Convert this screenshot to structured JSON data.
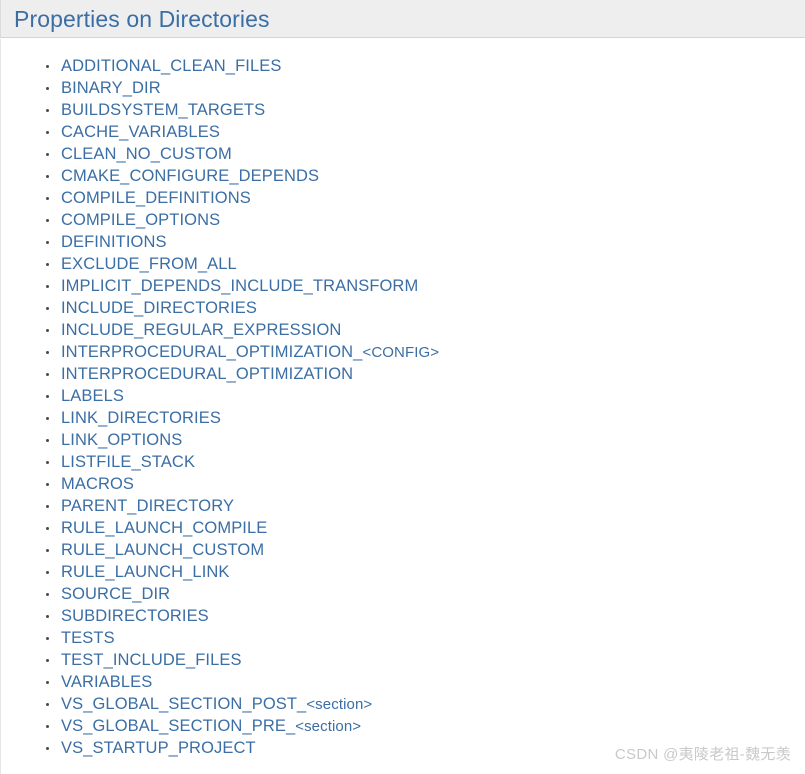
{
  "header": {
    "title": "Properties on Directories",
    "background_color": "#eeeeee",
    "title_color": "#3a6ea5"
  },
  "theme": {
    "link_color": "#3a6ea5",
    "page_background": "#ffffff",
    "bullet_color": "#4a4a4a"
  },
  "properties": [
    {
      "name": "ADDITIONAL_CLEAN_FILES"
    },
    {
      "name": "BINARY_DIR"
    },
    {
      "name": "BUILDSYSTEM_TARGETS"
    },
    {
      "name": "CACHE_VARIABLES"
    },
    {
      "name": "CLEAN_NO_CUSTOM"
    },
    {
      "name": "CMAKE_CONFIGURE_DEPENDS"
    },
    {
      "name": "COMPILE_DEFINITIONS"
    },
    {
      "name": "COMPILE_OPTIONS"
    },
    {
      "name": "DEFINITIONS"
    },
    {
      "name": "EXCLUDE_FROM_ALL"
    },
    {
      "name": "IMPLICIT_DEPENDS_INCLUDE_TRANSFORM"
    },
    {
      "name": "INCLUDE_DIRECTORIES"
    },
    {
      "name": "INCLUDE_REGULAR_EXPRESSION"
    },
    {
      "name": "INTERPROCEDURAL_OPTIMIZATION_",
      "variable": "<CONFIG>"
    },
    {
      "name": "INTERPROCEDURAL_OPTIMIZATION"
    },
    {
      "name": "LABELS"
    },
    {
      "name": "LINK_DIRECTORIES"
    },
    {
      "name": "LINK_OPTIONS"
    },
    {
      "name": "LISTFILE_STACK"
    },
    {
      "name": "MACROS"
    },
    {
      "name": "PARENT_DIRECTORY"
    },
    {
      "name": "RULE_LAUNCH_COMPILE"
    },
    {
      "name": "RULE_LAUNCH_CUSTOM"
    },
    {
      "name": "RULE_LAUNCH_LINK"
    },
    {
      "name": "SOURCE_DIR"
    },
    {
      "name": "SUBDIRECTORIES"
    },
    {
      "name": "TESTS"
    },
    {
      "name": "TEST_INCLUDE_FILES"
    },
    {
      "name": "VARIABLES"
    },
    {
      "name": "VS_GLOBAL_SECTION_POST_",
      "variable": "<section>"
    },
    {
      "name": "VS_GLOBAL_SECTION_PRE_",
      "variable": "<section>"
    },
    {
      "name": "VS_STARTUP_PROJECT"
    }
  ],
  "watermark": {
    "text": "CSDN @夷陵老祖-魏无羡",
    "color": "#c9c9c9"
  }
}
